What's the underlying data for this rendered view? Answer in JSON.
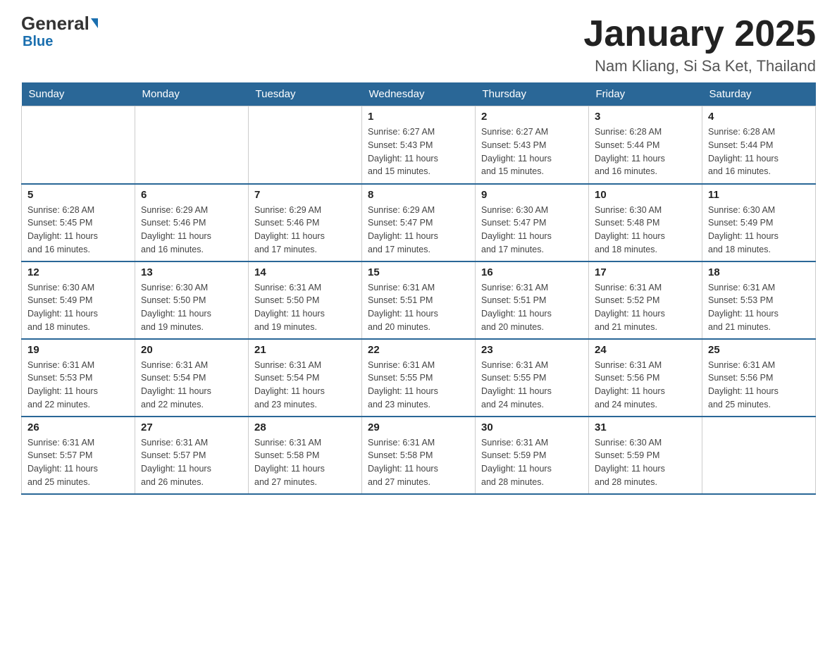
{
  "header": {
    "logo_general": "General",
    "logo_blue": "Blue",
    "title": "January 2025",
    "subtitle": "Nam Kliang, Si Sa Ket, Thailand"
  },
  "days_of_week": [
    "Sunday",
    "Monday",
    "Tuesday",
    "Wednesday",
    "Thursday",
    "Friday",
    "Saturday"
  ],
  "weeks": [
    [
      {
        "day": "",
        "info": ""
      },
      {
        "day": "",
        "info": ""
      },
      {
        "day": "",
        "info": ""
      },
      {
        "day": "1",
        "info": "Sunrise: 6:27 AM\nSunset: 5:43 PM\nDaylight: 11 hours\nand 15 minutes."
      },
      {
        "day": "2",
        "info": "Sunrise: 6:27 AM\nSunset: 5:43 PM\nDaylight: 11 hours\nand 15 minutes."
      },
      {
        "day": "3",
        "info": "Sunrise: 6:28 AM\nSunset: 5:44 PM\nDaylight: 11 hours\nand 16 minutes."
      },
      {
        "day": "4",
        "info": "Sunrise: 6:28 AM\nSunset: 5:44 PM\nDaylight: 11 hours\nand 16 minutes."
      }
    ],
    [
      {
        "day": "5",
        "info": "Sunrise: 6:28 AM\nSunset: 5:45 PM\nDaylight: 11 hours\nand 16 minutes."
      },
      {
        "day": "6",
        "info": "Sunrise: 6:29 AM\nSunset: 5:46 PM\nDaylight: 11 hours\nand 16 minutes."
      },
      {
        "day": "7",
        "info": "Sunrise: 6:29 AM\nSunset: 5:46 PM\nDaylight: 11 hours\nand 17 minutes."
      },
      {
        "day": "8",
        "info": "Sunrise: 6:29 AM\nSunset: 5:47 PM\nDaylight: 11 hours\nand 17 minutes."
      },
      {
        "day": "9",
        "info": "Sunrise: 6:30 AM\nSunset: 5:47 PM\nDaylight: 11 hours\nand 17 minutes."
      },
      {
        "day": "10",
        "info": "Sunrise: 6:30 AM\nSunset: 5:48 PM\nDaylight: 11 hours\nand 18 minutes."
      },
      {
        "day": "11",
        "info": "Sunrise: 6:30 AM\nSunset: 5:49 PM\nDaylight: 11 hours\nand 18 minutes."
      }
    ],
    [
      {
        "day": "12",
        "info": "Sunrise: 6:30 AM\nSunset: 5:49 PM\nDaylight: 11 hours\nand 18 minutes."
      },
      {
        "day": "13",
        "info": "Sunrise: 6:30 AM\nSunset: 5:50 PM\nDaylight: 11 hours\nand 19 minutes."
      },
      {
        "day": "14",
        "info": "Sunrise: 6:31 AM\nSunset: 5:50 PM\nDaylight: 11 hours\nand 19 minutes."
      },
      {
        "day": "15",
        "info": "Sunrise: 6:31 AM\nSunset: 5:51 PM\nDaylight: 11 hours\nand 20 minutes."
      },
      {
        "day": "16",
        "info": "Sunrise: 6:31 AM\nSunset: 5:51 PM\nDaylight: 11 hours\nand 20 minutes."
      },
      {
        "day": "17",
        "info": "Sunrise: 6:31 AM\nSunset: 5:52 PM\nDaylight: 11 hours\nand 21 minutes."
      },
      {
        "day": "18",
        "info": "Sunrise: 6:31 AM\nSunset: 5:53 PM\nDaylight: 11 hours\nand 21 minutes."
      }
    ],
    [
      {
        "day": "19",
        "info": "Sunrise: 6:31 AM\nSunset: 5:53 PM\nDaylight: 11 hours\nand 22 minutes."
      },
      {
        "day": "20",
        "info": "Sunrise: 6:31 AM\nSunset: 5:54 PM\nDaylight: 11 hours\nand 22 minutes."
      },
      {
        "day": "21",
        "info": "Sunrise: 6:31 AM\nSunset: 5:54 PM\nDaylight: 11 hours\nand 23 minutes."
      },
      {
        "day": "22",
        "info": "Sunrise: 6:31 AM\nSunset: 5:55 PM\nDaylight: 11 hours\nand 23 minutes."
      },
      {
        "day": "23",
        "info": "Sunrise: 6:31 AM\nSunset: 5:55 PM\nDaylight: 11 hours\nand 24 minutes."
      },
      {
        "day": "24",
        "info": "Sunrise: 6:31 AM\nSunset: 5:56 PM\nDaylight: 11 hours\nand 24 minutes."
      },
      {
        "day": "25",
        "info": "Sunrise: 6:31 AM\nSunset: 5:56 PM\nDaylight: 11 hours\nand 25 minutes."
      }
    ],
    [
      {
        "day": "26",
        "info": "Sunrise: 6:31 AM\nSunset: 5:57 PM\nDaylight: 11 hours\nand 25 minutes."
      },
      {
        "day": "27",
        "info": "Sunrise: 6:31 AM\nSunset: 5:57 PM\nDaylight: 11 hours\nand 26 minutes."
      },
      {
        "day": "28",
        "info": "Sunrise: 6:31 AM\nSunset: 5:58 PM\nDaylight: 11 hours\nand 27 minutes."
      },
      {
        "day": "29",
        "info": "Sunrise: 6:31 AM\nSunset: 5:58 PM\nDaylight: 11 hours\nand 27 minutes."
      },
      {
        "day": "30",
        "info": "Sunrise: 6:31 AM\nSunset: 5:59 PM\nDaylight: 11 hours\nand 28 minutes."
      },
      {
        "day": "31",
        "info": "Sunrise: 6:30 AM\nSunset: 5:59 PM\nDaylight: 11 hours\nand 28 minutes."
      },
      {
        "day": "",
        "info": ""
      }
    ]
  ]
}
